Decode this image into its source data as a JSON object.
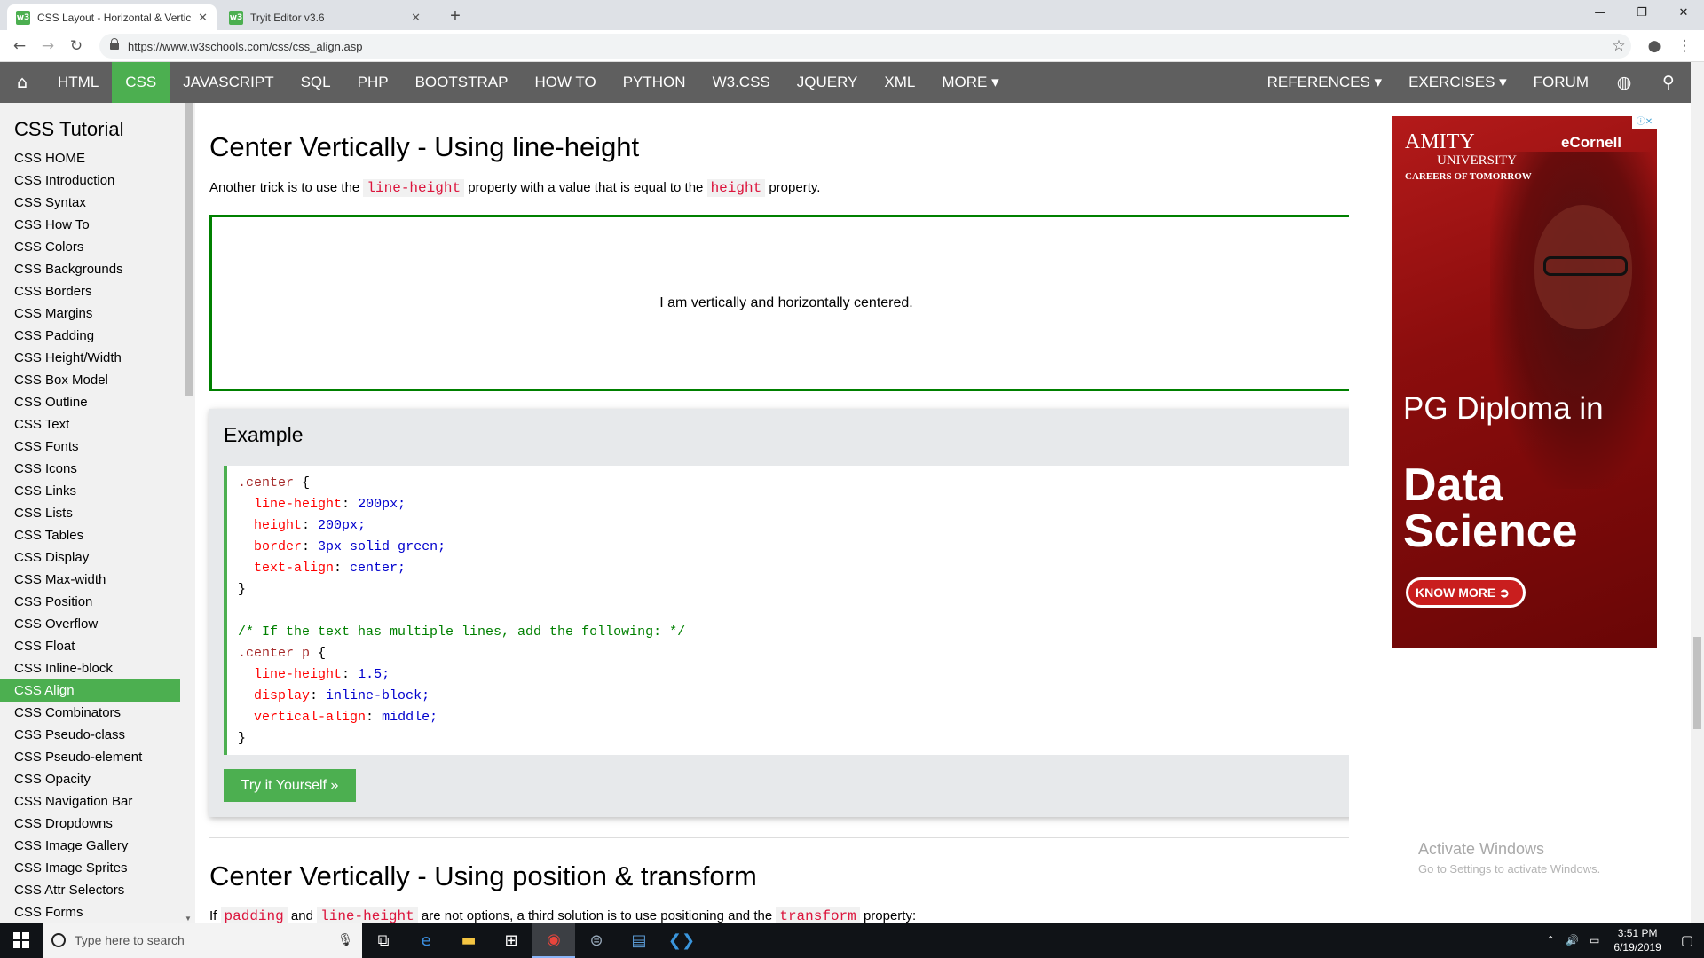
{
  "browser": {
    "tabs": [
      {
        "label": "CSS Layout - Horizontal & Vertic",
        "favicon": "w3"
      },
      {
        "label": "Tryit Editor v3.6",
        "favicon": "w3"
      }
    ],
    "url": "https://www.w3schools.com/css/css_align.asp"
  },
  "nav": {
    "items": [
      "HTML",
      "CSS",
      "JAVASCRIPT",
      "SQL",
      "PHP",
      "BOOTSTRAP",
      "HOW TO",
      "PYTHON",
      "W3.CSS",
      "JQUERY",
      "XML",
      "MORE ▾"
    ],
    "right": [
      "REFERENCES ▾",
      "EXERCISES ▾",
      "FORUM"
    ],
    "active": "CSS",
    "accent": "#4caf50",
    "bar_color": "#5f5f5f"
  },
  "sidebar": {
    "title": "CSS Tutorial",
    "items": [
      "CSS HOME",
      "CSS Introduction",
      "CSS Syntax",
      "CSS How To",
      "CSS Colors",
      "CSS Backgrounds",
      "CSS Borders",
      "CSS Margins",
      "CSS Padding",
      "CSS Height/Width",
      "CSS Box Model",
      "CSS Outline",
      "CSS Text",
      "CSS Fonts",
      "CSS Icons",
      "CSS Links",
      "CSS Lists",
      "CSS Tables",
      "CSS Display",
      "CSS Max-width",
      "CSS Position",
      "CSS Overflow",
      "CSS Float",
      "CSS Inline-block",
      "CSS Align",
      "CSS Combinators",
      "CSS Pseudo-class",
      "CSS Pseudo-element",
      "CSS Opacity",
      "CSS Navigation Bar",
      "CSS Dropdowns",
      "CSS Image Gallery",
      "CSS Image Sprites",
      "CSS Attr Selectors",
      "CSS Forms"
    ],
    "active": "CSS Align"
  },
  "main": {
    "heading1": "Center Vertically - Using line-height",
    "para1_a": "Another trick is to use the",
    "para1_code1": "line-height",
    "para1_b": "property with a value that is equal to the",
    "para1_code2": "height",
    "para1_c": "property.",
    "demo_text": "I am vertically and horizontally centered.",
    "example_title": "Example",
    "code": {
      "sel1": ".center",
      "l1p": "line-height",
      "l1v": "200px;",
      "l2p": "height",
      "l2v": "200px;",
      "l3p": "border",
      "l3v": "3px solid green;",
      "l4p": "text-align",
      "l4v": "center;",
      "comment": "/* If the text has multiple lines, add the following: */",
      "sel2": ".center p",
      "m1p": "line-height",
      "m1v": "1.5;",
      "m2p": "display",
      "m2v": "inline-block;",
      "m3p": "vertical-align",
      "m3v": "middle;"
    },
    "try_button": "Try it Yourself »",
    "heading2": "Center Vertically - Using position & transform",
    "para2_a": "If",
    "para2_code1": "padding",
    "para2_b": "and",
    "para2_code2": "line-height",
    "para2_c": "are not options, a third solution is to use positioning and the",
    "para2_code3": "transform",
    "para2_d": "property:"
  },
  "ad": {
    "brand": "AMITY",
    "university": "UNIVERSITY",
    "tagline": "CAREERS OF TOMORROW",
    "partner": "eCornell",
    "headline": "PG Diploma in",
    "subject_line1": "Data",
    "subject_line2": "Science",
    "cta": "KNOW MORE"
  },
  "watermark": {
    "title": "Activate Windows",
    "subtitle": "Go to Settings to activate Windows."
  },
  "taskbar": {
    "search_placeholder": "Type here to search",
    "time": "3:51 PM",
    "date": "6/19/2019"
  }
}
